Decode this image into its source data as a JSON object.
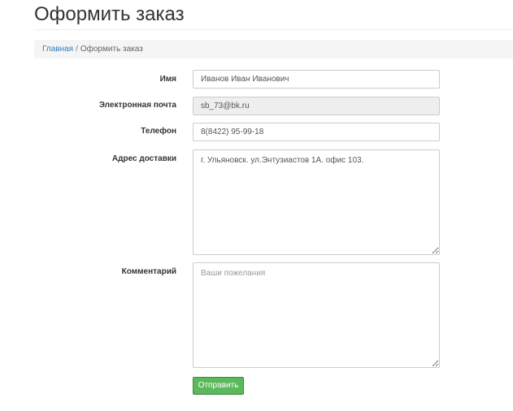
{
  "header": {
    "title": "Оформить заказ"
  },
  "breadcrumb": {
    "home": "Главная",
    "separator": "/",
    "current": "Оформить заказ"
  },
  "form": {
    "name": {
      "label": "Имя",
      "value": "Иванов Иван Иванович"
    },
    "email": {
      "label": "Электронная почта",
      "value": "sb_73@bk.ru"
    },
    "phone": {
      "label": "Телефон",
      "value": "8(8422) 95-99-18"
    },
    "address": {
      "label": "Адрес доставки",
      "value": "г. Ульяновск. ул.Энтузиастов 1А. офис 103."
    },
    "comment": {
      "label": "Комментарий",
      "value": "",
      "placeholder": "Ваши пожелания"
    },
    "submit_label": "Отправить"
  },
  "colors": {
    "link": "#337ab7",
    "submit": "#5cb85c",
    "breadcrumb_bg": "#f5f5f5",
    "readonly_bg": "#eeeeee"
  }
}
